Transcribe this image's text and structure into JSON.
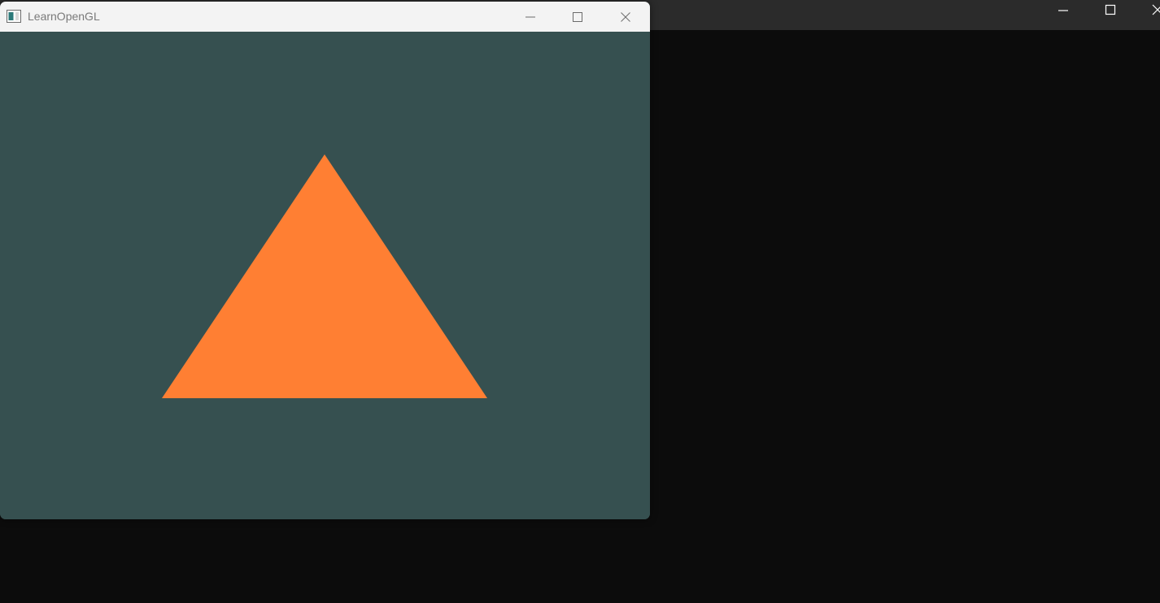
{
  "desktop": {
    "background_color": "#0c0c0c",
    "background_titlebar_color": "#2b2b2b",
    "controls": {
      "minimize_icon": "minimize-icon",
      "maximize_icon": "maximize-icon",
      "close_icon": "close-icon"
    }
  },
  "window": {
    "title": "LearnOpenGL",
    "app_icon": "window-app-icon",
    "titlebar_color": "#f3f3f3",
    "controls": {
      "minimize_icon": "minimize-icon",
      "maximize_icon": "maximize-icon",
      "close_icon": "close-icon"
    }
  },
  "render": {
    "clear_color": "#365050",
    "shape": "triangle",
    "fill_color": "#ff7f33"
  }
}
